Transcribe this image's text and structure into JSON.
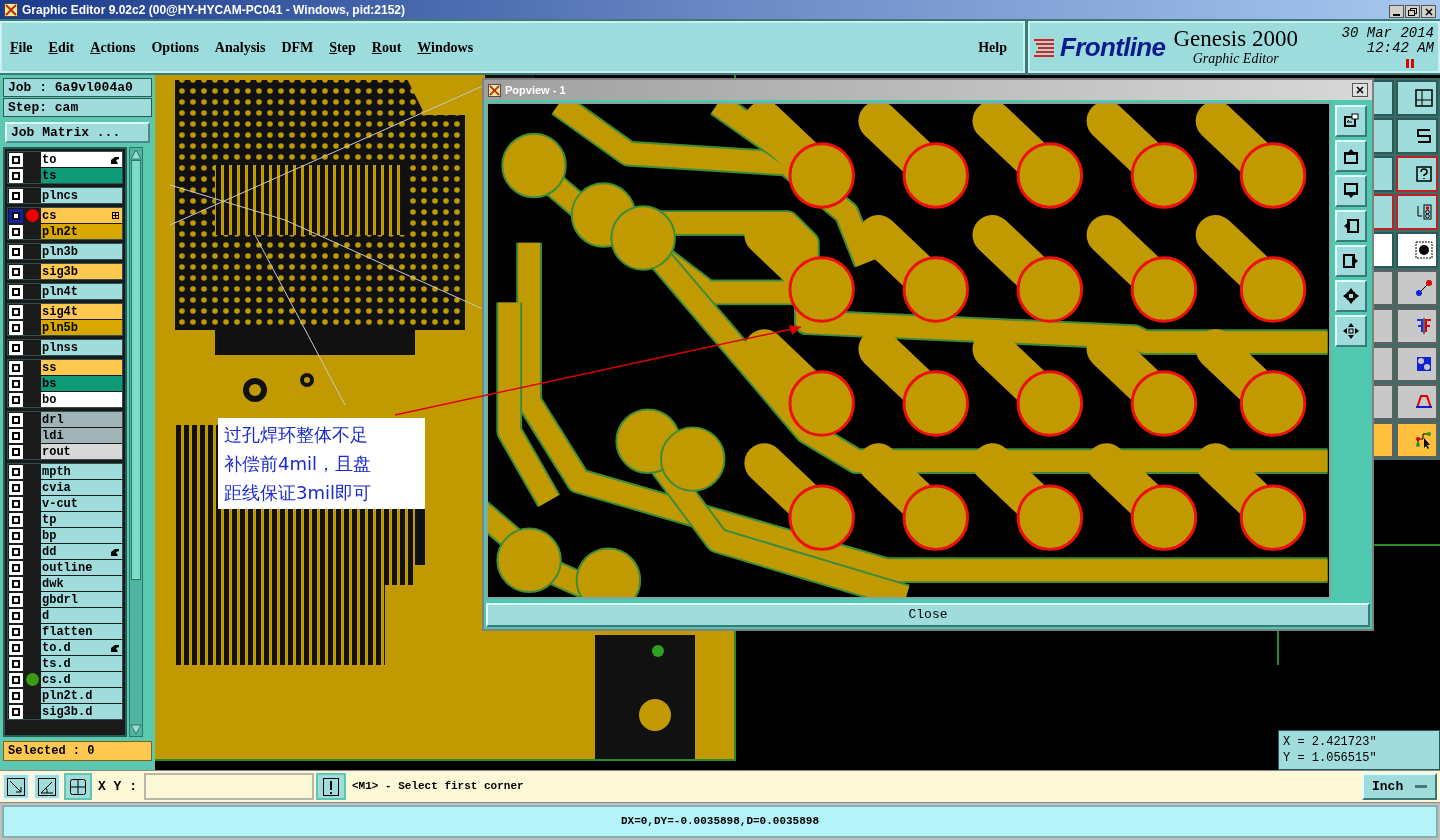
{
  "window": {
    "title": "Graphic Editor 9.02c2 (00@HY-HYCAM-PC041 - Windows, pid:2152)"
  },
  "menu": [
    {
      "label": "File",
      "mnemonic": true
    },
    {
      "label": "Edit",
      "mnemonic": true
    },
    {
      "label": "Actions",
      "mnemonic": true
    },
    {
      "label": "Options",
      "mnemonic": false
    },
    {
      "label": "Analysis",
      "mnemonic": false
    },
    {
      "label": "DFM",
      "mnemonic": false
    },
    {
      "label": "Step",
      "mnemonic": true
    },
    {
      "label": "Rout",
      "mnemonic": true
    },
    {
      "label": "Windows",
      "mnemonic": true
    }
  ],
  "help": "Help",
  "brand": {
    "logo": "Frontline",
    "product": "Genesis 2000",
    "subtitle": "Graphic Editor",
    "date": "30 Mar 2014",
    "time": "12:42 AM"
  },
  "job": {
    "job": "Job : 6a9vl004a0",
    "step": "Step: cam",
    "matrix_button": "Job Matrix ..."
  },
  "layer_groups": [
    {
      "layers": [
        {
          "name": "to",
          "color": "#ffffff",
          "active": false,
          "pointer": true
        },
        {
          "name": "ts",
          "color": "#0f9a78",
          "active": false,
          "pointer": false
        }
      ]
    },
    {
      "layers": [
        {
          "name": "plncs",
          "color": "#a0dcdc",
          "active": false,
          "pointer": false
        }
      ]
    },
    {
      "layers": [
        {
          "name": "cs",
          "color": "#ffc850",
          "active": true,
          "pointer": false,
          "dot": {
            "color": "#ee0000"
          }
        },
        {
          "name": "pln2t",
          "color": "#d8a800",
          "active": false,
          "pointer": false
        }
      ]
    },
    {
      "layers": [
        {
          "name": "pln3b",
          "color": "#a0dcdc",
          "active": false,
          "pointer": false
        }
      ]
    },
    {
      "layers": [
        {
          "name": "sig3b",
          "color": "#ffc850",
          "active": false,
          "pointer": false
        }
      ]
    },
    {
      "layers": [
        {
          "name": "pln4t",
          "color": "#a0dcdc",
          "active": false,
          "pointer": false
        }
      ]
    },
    {
      "layers": [
        {
          "name": "sig4t",
          "color": "#ffc850",
          "active": false,
          "pointer": false
        },
        {
          "name": "pln5b",
          "color": "#d8a800",
          "active": false,
          "pointer": false
        }
      ]
    },
    {
      "layers": [
        {
          "name": "plnss",
          "color": "#a0dcdc",
          "active": false,
          "pointer": false
        }
      ]
    },
    {
      "layers": [
        {
          "name": "ss",
          "color": "#ffc850",
          "active": false,
          "pointer": false
        },
        {
          "name": "bs",
          "color": "#0f9a78",
          "active": false,
          "pointer": false
        },
        {
          "name": "bo",
          "color": "#ffffff",
          "active": false,
          "pointer": false
        }
      ]
    },
    {
      "layers": [
        {
          "name": "drl",
          "color": "#a0b4b8",
          "active": false,
          "pointer": false
        },
        {
          "name": "ldi",
          "color": "#a0b4b8",
          "active": false,
          "pointer": false
        },
        {
          "name": "rout",
          "color": "#d8d8d8",
          "active": false,
          "pointer": false
        }
      ]
    },
    {
      "layers": [
        {
          "name": "mpth",
          "color": "#a0dcdc",
          "active": false,
          "pointer": false
        },
        {
          "name": "cvia",
          "color": "#a0dcdc",
          "active": false,
          "pointer": false
        },
        {
          "name": "v-cut",
          "color": "#a0dcdc",
          "active": false,
          "pointer": false
        },
        {
          "name": "tp",
          "color": "#a0dcdc",
          "active": false,
          "pointer": false
        },
        {
          "name": "bp",
          "color": "#a0dcdc",
          "active": false,
          "pointer": false
        },
        {
          "name": "dd",
          "color": "#a0dcdc",
          "active": false,
          "pointer": true
        },
        {
          "name": "outline",
          "color": "#a0dcdc",
          "active": false,
          "pointer": false
        },
        {
          "name": "dwk",
          "color": "#a0dcdc",
          "active": false,
          "pointer": false
        },
        {
          "name": "gbdrl",
          "color": "#a0dcdc",
          "active": false,
          "pointer": false
        },
        {
          "name": "d",
          "color": "#a0dcdc",
          "active": false,
          "pointer": false
        },
        {
          "name": "flatten",
          "color": "#a0dcdc",
          "active": false,
          "pointer": false
        },
        {
          "name": "to.d",
          "color": "#a0dcdc",
          "active": false,
          "pointer": true
        },
        {
          "name": "ts.d",
          "color": "#a0dcdc",
          "active": false,
          "pointer": false
        },
        {
          "name": "cs.d",
          "color": "#a0dcdc",
          "active": false,
          "pointer": false,
          "dot": {
            "color": "#3a9a10"
          }
        },
        {
          "name": "pln2t.d",
          "color": "#a0dcdc",
          "active": false,
          "pointer": false
        },
        {
          "name": "sig3b.d",
          "color": "#a0dcdc",
          "active": false,
          "pointer": false
        }
      ]
    }
  ],
  "selected_count": "Selected : 0",
  "annotation": {
    "lines": [
      "过孔焊环整体不足",
      "补偿前4mil，且盘",
      "距线保证3mil即可"
    ]
  },
  "popup": {
    "title": "Popview - 1",
    "close_button": "Close"
  },
  "coordinates": {
    "x": "X = 2.421723\"",
    "y": "Y = 1.056515\""
  },
  "command": {
    "xy_label": "X Y :",
    "prompt": "<M1> - Select first corner",
    "units": "Inch"
  },
  "status": "DX=0,DY=-0.0035898,D=0.0035898"
}
